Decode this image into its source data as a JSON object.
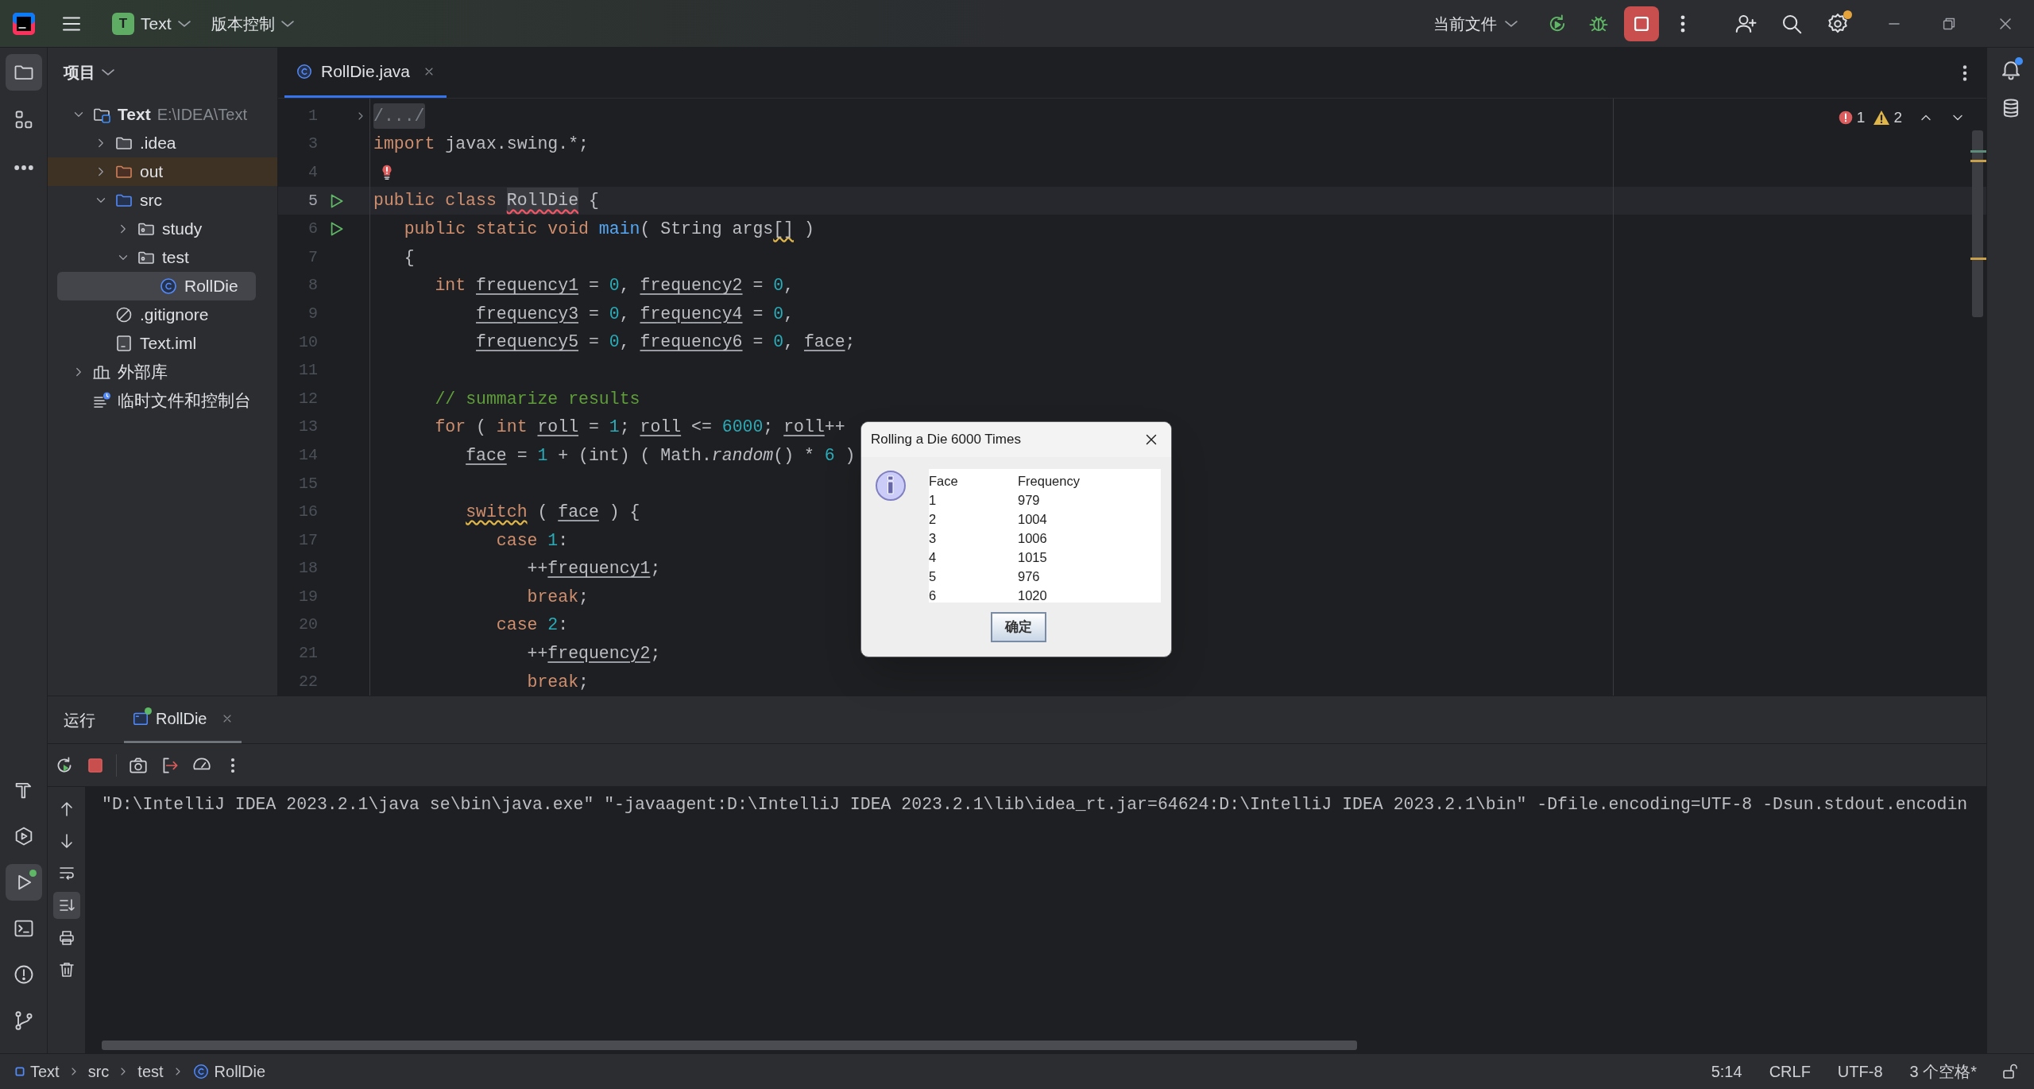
{
  "title_bar": {
    "project_badge": "T",
    "project": "Text",
    "vcs": "版本控制",
    "run_config": "当前文件"
  },
  "left_tools": [
    {
      "kind": "project",
      "selected": true
    },
    {
      "kind": "structure",
      "selected": false
    },
    {
      "kind": "more",
      "selected": false
    },
    {
      "kind": "build",
      "selected": false
    },
    {
      "kind": "services",
      "selected": false
    },
    {
      "kind": "run",
      "selected": true
    },
    {
      "kind": "terminal",
      "selected": false
    },
    {
      "kind": "problems",
      "selected": false
    },
    {
      "kind": "git",
      "selected": false
    }
  ],
  "project_panel": {
    "title": "项目",
    "tree": [
      {
        "kind": "project",
        "label": "Text",
        "path": "E:\\IDEA\\Text",
        "expanded": true,
        "selected": false,
        "children": [
          {
            "kind": "folder",
            "label": ".idea",
            "expanded": false,
            "selected": false
          },
          {
            "kind": "excluded",
            "label": "out",
            "expanded": false,
            "selected": false
          },
          {
            "kind": "source",
            "label": "src",
            "expanded": true,
            "selected": false,
            "children": [
              {
                "kind": "package",
                "label": "study",
                "expanded": false,
                "selected": false
              },
              {
                "kind": "package",
                "label": "test",
                "expanded": true,
                "selected": false,
                "children": [
                  {
                    "kind": "class",
                    "label": "RollDie",
                    "selected": true
                  }
                ]
              }
            ]
          },
          {
            "kind": "ignore",
            "label": ".gitignore",
            "selected": false
          },
          {
            "kind": "module",
            "label": "Text.iml",
            "selected": false
          }
        ]
      },
      {
        "kind": "library",
        "label": "外部库",
        "expanded": false,
        "selected": false
      },
      {
        "kind": "scratch",
        "label": "临时文件和控制台",
        "selected": false
      }
    ]
  },
  "editor": {
    "tabs": [
      {
        "label": "RollDie.java",
        "selected": true
      }
    ],
    "errors": "1",
    "warnings": "2",
    "lines": [
      {
        "number": "1",
        "folded": true,
        "segments": [
          {
            "kind": "fold",
            "text": "/.../"
          }
        ]
      },
      {
        "number": "3",
        "segments": [
          {
            "kind": "kw",
            "text": "import"
          },
          {
            "kind": "plain",
            "text": " javax.swing.*;"
          }
        ]
      },
      {
        "number": "4",
        "bulb": true
      },
      {
        "number": "5",
        "run": true,
        "current": true,
        "segments": [
          {
            "kind": "kw",
            "text": "public class "
          },
          {
            "kind": "error",
            "text": "RollDie"
          },
          {
            "kind": "plain",
            "text": " {"
          }
        ]
      },
      {
        "number": "6",
        "run": true,
        "segments": [
          {
            "kind": "kw",
            "text": "   public static void "
          },
          {
            "kind": "call",
            "text": "main"
          },
          {
            "kind": "plain",
            "text": "( String args"
          },
          {
            "kind": "warn",
            "text": "[]"
          },
          {
            "kind": "plain",
            "text": " )"
          }
        ]
      },
      {
        "number": "7",
        "segments": [
          {
            "kind": "plain",
            "text": "   {"
          }
        ]
      },
      {
        "number": "8",
        "segments": [
          {
            "kind": "kw",
            "text": "      int "
          },
          {
            "kind": "var",
            "text": "frequency1"
          },
          {
            "kind": "plain",
            "text": " = "
          },
          {
            "kind": "num",
            "text": "0"
          },
          {
            "kind": "plain",
            "text": ", "
          },
          {
            "kind": "var",
            "text": "frequency2"
          },
          {
            "kind": "plain",
            "text": " = "
          },
          {
            "kind": "num",
            "text": "0"
          },
          {
            "kind": "plain",
            "text": ","
          }
        ]
      },
      {
        "number": "9",
        "segments": [
          {
            "kind": "var",
            "text": "          frequency3"
          },
          {
            "kind": "plain",
            "text": " = "
          },
          {
            "kind": "num",
            "text": "0"
          },
          {
            "kind": "plain",
            "text": ", "
          },
          {
            "kind": "var",
            "text": "frequency4"
          },
          {
            "kind": "plain",
            "text": " = "
          },
          {
            "kind": "num",
            "text": "0"
          },
          {
            "kind": "plain",
            "text": ","
          }
        ]
      },
      {
        "number": "10",
        "segments": [
          {
            "kind": "var",
            "text": "          frequency5"
          },
          {
            "kind": "plain",
            "text": " = "
          },
          {
            "kind": "num",
            "text": "0"
          },
          {
            "kind": "plain",
            "text": ", "
          },
          {
            "kind": "var",
            "text": "frequency6"
          },
          {
            "kind": "plain",
            "text": " = "
          },
          {
            "kind": "num",
            "text": "0"
          },
          {
            "kind": "plain",
            "text": ", "
          },
          {
            "kind": "var",
            "text": "face"
          },
          {
            "kind": "plain",
            "text": ";"
          }
        ]
      },
      {
        "number": "11"
      },
      {
        "number": "12",
        "segments": [
          {
            "kind": "comment",
            "text": "      // summarize results"
          }
        ]
      },
      {
        "number": "13",
        "segments": [
          {
            "kind": "kw",
            "text": "      for"
          },
          {
            "kind": "plain",
            "text": " ( "
          },
          {
            "kind": "kw",
            "text": "int "
          },
          {
            "kind": "var",
            "text": "roll"
          },
          {
            "kind": "plain",
            "text": " = "
          },
          {
            "kind": "num",
            "text": "1"
          },
          {
            "kind": "plain",
            "text": "; "
          },
          {
            "kind": "var",
            "text": "roll"
          },
          {
            "kind": "plain",
            "text": " <= "
          },
          {
            "kind": "num",
            "text": "6000"
          },
          {
            "kind": "plain",
            "text": "; "
          },
          {
            "kind": "var",
            "text": "roll"
          },
          {
            "kind": "plain",
            "text": "++"
          }
        ]
      },
      {
        "number": "14",
        "segments": [
          {
            "kind": "var",
            "text": "         face"
          },
          {
            "kind": "plain",
            "text": " = "
          },
          {
            "kind": "num",
            "text": "1"
          },
          {
            "kind": "plain",
            "text": " + (int) ( Math."
          },
          {
            "kind": "italic",
            "text": "random"
          },
          {
            "kind": "plain",
            "text": "() * "
          },
          {
            "kind": "num",
            "text": "6"
          },
          {
            "kind": "plain",
            "text": " )"
          }
        ]
      },
      {
        "number": "15"
      },
      {
        "number": "16",
        "segments": [
          {
            "kind": "kw-warn",
            "text": "         switch"
          },
          {
            "kind": "plain",
            "text": " ( "
          },
          {
            "kind": "var",
            "text": "face"
          },
          {
            "kind": "plain",
            "text": " ) {"
          }
        ]
      },
      {
        "number": "17",
        "segments": [
          {
            "kind": "kw",
            "text": "            case "
          },
          {
            "kind": "num",
            "text": "1"
          },
          {
            "kind": "plain",
            "text": ":"
          }
        ]
      },
      {
        "number": "18",
        "segments": [
          {
            "kind": "plain",
            "text": "               ++"
          },
          {
            "kind": "var",
            "text": "frequency1"
          },
          {
            "kind": "plain",
            "text": ";"
          }
        ]
      },
      {
        "number": "19",
        "segments": [
          {
            "kind": "kw",
            "text": "               break"
          },
          {
            "kind": "plain",
            "text": ";"
          }
        ]
      },
      {
        "number": "20",
        "segments": [
          {
            "kind": "kw",
            "text": "            case "
          },
          {
            "kind": "num",
            "text": "2"
          },
          {
            "kind": "plain",
            "text": ":"
          }
        ]
      },
      {
        "number": "21",
        "segments": [
          {
            "kind": "plain",
            "text": "               ++"
          },
          {
            "kind": "var",
            "text": "frequency2"
          },
          {
            "kind": "plain",
            "text": ";"
          }
        ]
      },
      {
        "number": "22",
        "segments": [
          {
            "kind": "kw",
            "text": "               break"
          },
          {
            "kind": "plain",
            "text": ";"
          }
        ]
      }
    ]
  },
  "dialog": {
    "title": "Rolling a Die 6000 Times",
    "header": [
      "Face",
      "Frequency"
    ],
    "rows": [
      [
        "1",
        "979"
      ],
      [
        "2",
        "1004"
      ],
      [
        "3",
        "1006"
      ],
      [
        "4",
        "1015"
      ],
      [
        "5",
        "976"
      ],
      [
        "6",
        "1020"
      ]
    ],
    "button": "确定"
  },
  "run_panel": {
    "title": "运行",
    "tabs": [
      {
        "label": "RollDie",
        "selected": true
      }
    ],
    "console": "\"D:\\IntelliJ IDEA 2023.2.1\\java se\\bin\\java.exe\" \"-javaagent:D:\\IntelliJ IDEA 2023.2.1\\lib\\idea_rt.jar=64624:D:\\IntelliJ IDEA 2023.2.1\\bin\" -Dfile.encoding=UTF-8 -Dsun.stdout.encodin"
  },
  "status_bar": {
    "breadcrumbs": [
      {
        "kind": "module",
        "label": "Text"
      },
      {
        "kind": "folder",
        "label": "src"
      },
      {
        "kind": "folder",
        "label": "test"
      },
      {
        "kind": "class",
        "label": "RollDie"
      }
    ],
    "items": [
      "5:14",
      "CRLF",
      "UTF-8",
      "3 个空格*"
    ]
  }
}
